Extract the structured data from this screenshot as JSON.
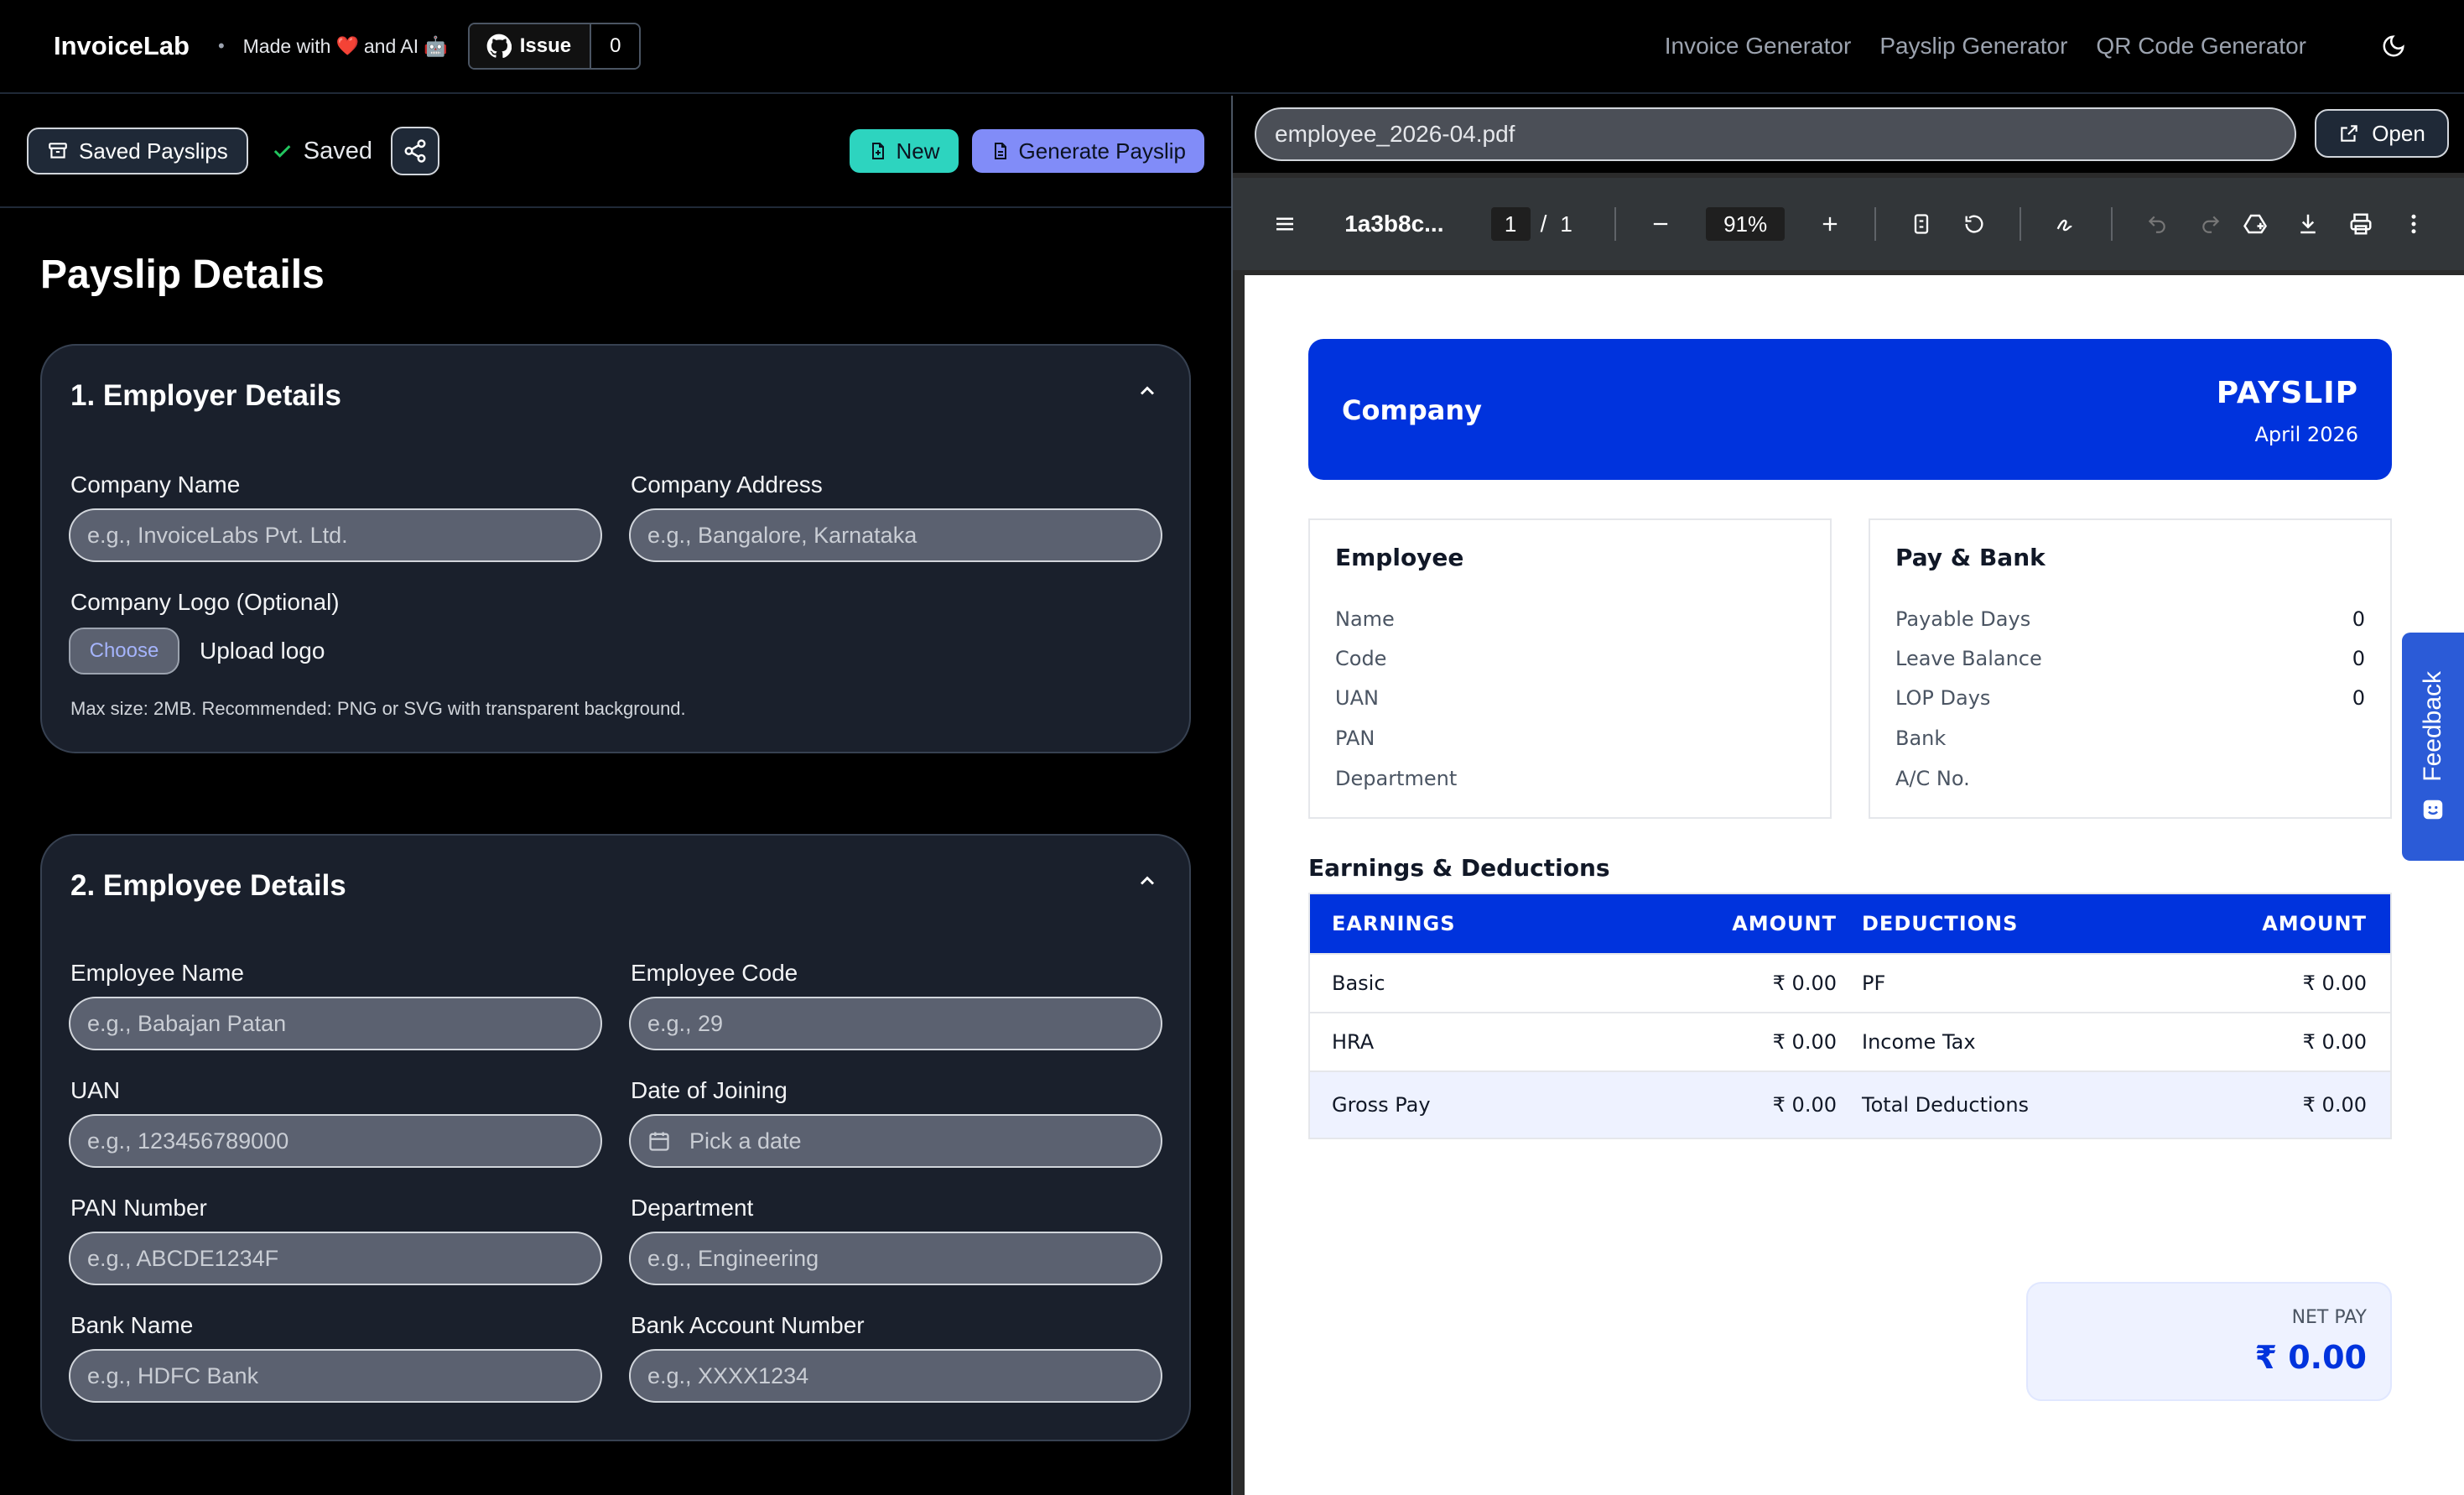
{
  "nav": {
    "brand": "InvoiceLab",
    "separator": "•",
    "made_prefix": "Made with",
    "made_mid": "and AI",
    "heart_glyph": "❤️",
    "robot_glyph": "🤖",
    "issue_label": "Issue",
    "issue_count": "0",
    "links": [
      "Invoice Generator",
      "Payslip Generator",
      "QR Code Generator"
    ]
  },
  "toolbar": {
    "saved_payslips": "Saved Payslips",
    "saved_status": "Saved",
    "new_label": "New",
    "generate_label": "Generate Payslip"
  },
  "form": {
    "title": "Payslip Details",
    "employer": {
      "title": "1. Employer Details",
      "company_name_label": "Company Name",
      "company_name_placeholder": "e.g., InvoiceLabs Pvt. Ltd.",
      "company_address_label": "Company Address",
      "company_address_placeholder": "e.g., Bangalore, Karnataka",
      "logo_label": "Company Logo (Optional)",
      "choose_label": "Choose",
      "upload_text": "Upload logo",
      "hint": "Max size: 2MB. Recommended: PNG or SVG with transparent background."
    },
    "employee": {
      "title": "2. Employee Details",
      "name_label": "Employee Name",
      "name_placeholder": "e.g., Babajan Patan",
      "code_label": "Employee Code",
      "code_placeholder": "e.g., 29",
      "uan_label": "UAN",
      "uan_placeholder": "e.g., 123456789000",
      "doj_label": "Date of Joining",
      "doj_placeholder": "Pick a date",
      "pan_label": "PAN Number",
      "pan_placeholder": "e.g., ABCDE1234F",
      "dept_label": "Department",
      "dept_placeholder": "e.g., Engineering",
      "bank_label": "Bank Name",
      "bank_placeholder": "e.g., HDFC Bank",
      "account_label": "Bank Account Number",
      "account_placeholder": "e.g., XXXX1234"
    }
  },
  "viewer": {
    "filename": "employee_2026-04.pdf",
    "open_label": "Open",
    "doc_title": "1a3b8c...",
    "page_current": "1",
    "page_sep": "/",
    "page_total": "1",
    "zoom": "91%"
  },
  "payslip": {
    "company": "Company",
    "title": "PAYSLIP",
    "period": "April 2026",
    "employee_heading": "Employee",
    "employee_fields": [
      "Name",
      "Code",
      "UAN",
      "PAN",
      "Department"
    ],
    "pay_heading": "Pay & Bank",
    "pay_fields": [
      {
        "label": "Payable Days",
        "value": "0"
      },
      {
        "label": "Leave Balance",
        "value": "0"
      },
      {
        "label": "LOP Days",
        "value": "0"
      },
      {
        "label": "Bank",
        "value": ""
      },
      {
        "label": "A/C No.",
        "value": ""
      }
    ],
    "section_title": "Earnings & Deductions",
    "headers": [
      "EARNINGS",
      "AMOUNT",
      "DEDUCTIONS",
      "AMOUNT"
    ],
    "rows": [
      [
        "Basic",
        "₹ 0.00",
        "PF",
        "₹ 0.00"
      ],
      [
        "HRA",
        "₹ 0.00",
        "Income Tax",
        "₹ 0.00"
      ],
      [
        "Gross Pay",
        "₹ 0.00",
        "Total Deductions",
        "₹ 0.00"
      ]
    ],
    "net_label": "NET PAY",
    "net_value": "₹ 0.00"
  },
  "feedback": {
    "label": "Feedback"
  },
  "colors": {
    "accent_teal": "#2dd4bf",
    "accent_indigo": "#818cf8",
    "payslip_blue": "#0033dd"
  }
}
